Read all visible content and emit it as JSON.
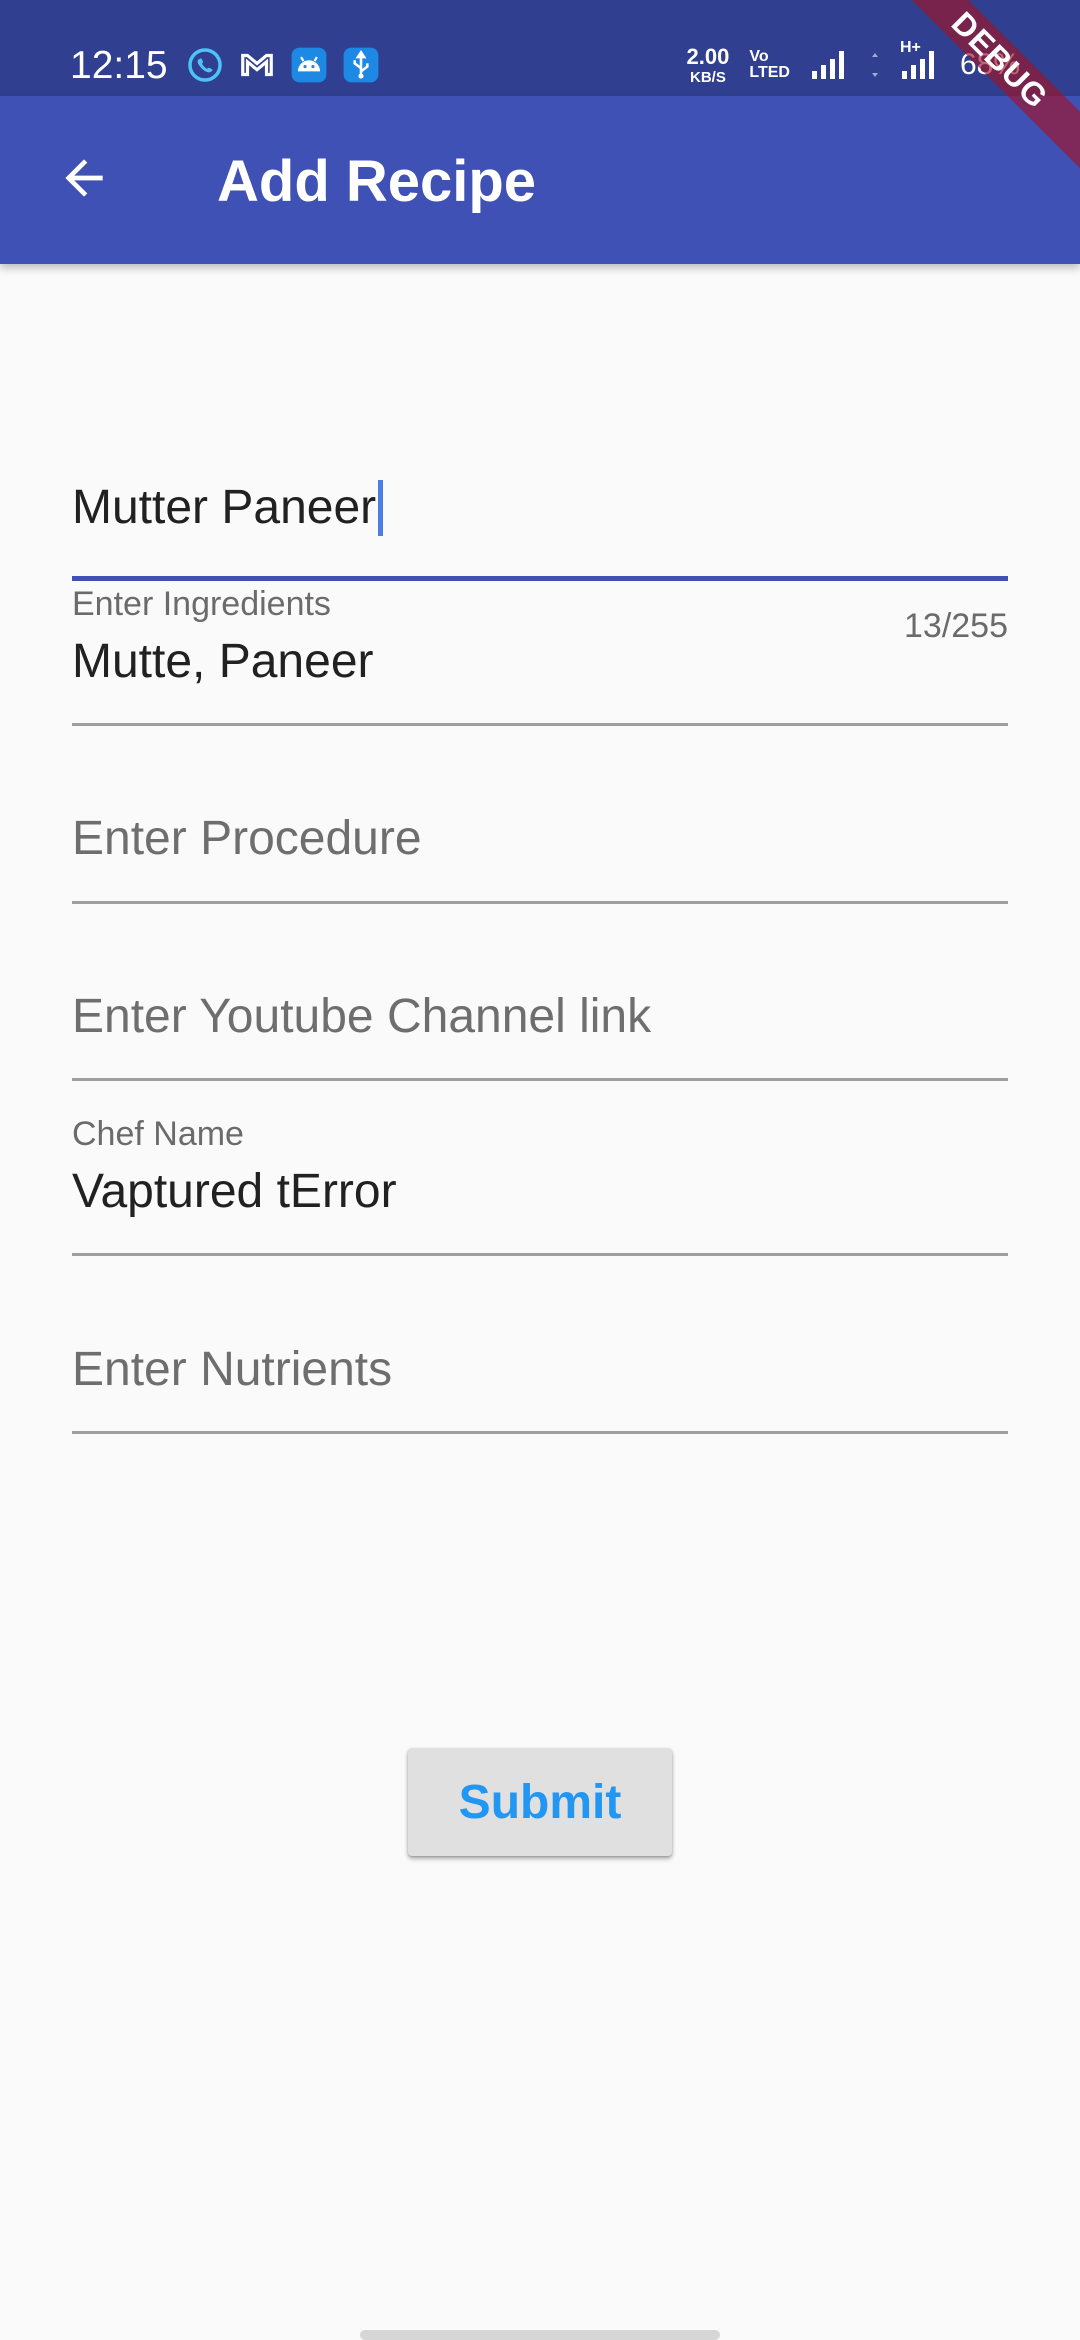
{
  "status_bar": {
    "time": "12:15",
    "notifications": [
      "whatsapp-icon",
      "gmail-icon",
      "android-icon",
      "usb-icon"
    ],
    "net_speed": "2.00",
    "net_speed_unit": "KB/S",
    "volte_top": "Vo",
    "volte_bottom": "LTED",
    "network_type": "H+",
    "battery": "68%",
    "debug_banner": "DEBUG"
  },
  "app_bar": {
    "title": "Add Recipe",
    "back_icon": "arrow-back-icon"
  },
  "form": {
    "recipe_name": {
      "value": "Mutter Paneer",
      "counter": "13/255",
      "focused": true
    },
    "ingredients": {
      "label": "Enter Ingredients",
      "value": "Mutte, Paneer"
    },
    "procedure": {
      "placeholder": "Enter Procedure"
    },
    "youtube_link": {
      "placeholder": "Enter Youtube Channel link"
    },
    "chef_name": {
      "label": "Chef Name",
      "value": "Vaptured tError"
    },
    "nutrients": {
      "placeholder": "Enter Nutrients"
    }
  },
  "submit": {
    "label": "Submit"
  },
  "colors": {
    "status_bar": "#303f8f",
    "app_bar": "#3f51b5",
    "accent": "#3f51b5",
    "button_text": "#2196f3",
    "background": "#fafafa"
  }
}
